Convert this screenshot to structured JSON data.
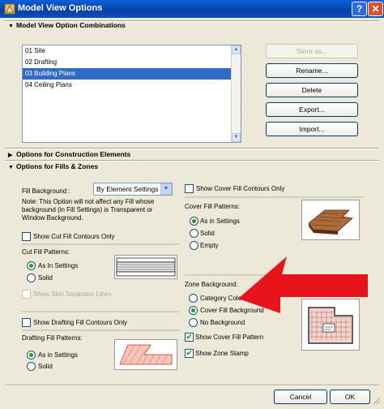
{
  "window": {
    "title": "Model View Options",
    "help_label": "?",
    "close_label": "✕",
    "app_icon": "archicad-icon"
  },
  "sections": {
    "combinations": {
      "label": "Model View Option Combinations",
      "expanded": true
    },
    "construction": {
      "label": "Options for Construction Elements",
      "expanded": false
    },
    "fills_zones": {
      "label": "Options for Fills & Zones",
      "expanded": true
    }
  },
  "combinations_list": {
    "items": [
      "01 Site",
      "02 Drafting",
      "03 Building Plans",
      "04 Ceiling Plans"
    ],
    "selected": "03 Building Plans"
  },
  "combination_buttons": {
    "store_as": "Store as...",
    "rename": "Rename...",
    "delete": "Delete",
    "export": "Export...",
    "import": "Import..."
  },
  "fill_background": {
    "label": "Fill Background :",
    "value": "By Element Settings",
    "note": "Note: This Option will not affect any Fill whose background (in Fill Settings) is Transparent or Window Background."
  },
  "cut_fill": {
    "contours_label": "Show Cut Fill Contours Only",
    "contours_checked": false,
    "patterns_label": "Cut Fill Patterns:",
    "options": [
      "As In Settings",
      "Solid"
    ],
    "selected": "As In Settings",
    "skin_label": "Show Skin Separator Lines",
    "skin_checked": false
  },
  "drafting_fill": {
    "contours_label": "Show Drafting Fill Contours Only",
    "contours_checked": false,
    "patterns_label": "Drafting Fill Patterns:",
    "options": [
      "As in Settings",
      "Solid"
    ],
    "selected": "As in Settings"
  },
  "cover_fill": {
    "contours_label": "Show Cover Fill Contours Only",
    "contours_checked": false,
    "patterns_label": "Cover Fill Patterns:",
    "options": [
      "As in Settings",
      "Solid",
      "Empty"
    ],
    "selected": "As in Settings"
  },
  "zone": {
    "background_label": "Zone Background:",
    "options": [
      "Category Color",
      "Cover Fill Background",
      "No Background"
    ],
    "selected": "Cover Fill Background",
    "show_cover_pattern_label": "Show Cover Fill Pattern",
    "show_cover_pattern_checked": true,
    "show_stamp_label": "Show Zone Stamp",
    "show_stamp_checked": true
  },
  "dialog_buttons": {
    "cancel": "Cancel",
    "ok": "OK"
  },
  "colors": {
    "title_bar": "#0A5FD8",
    "selection": "#316AC5",
    "arrow": "#E8141B",
    "check": "#21A121",
    "face": "#ECE9D8"
  }
}
